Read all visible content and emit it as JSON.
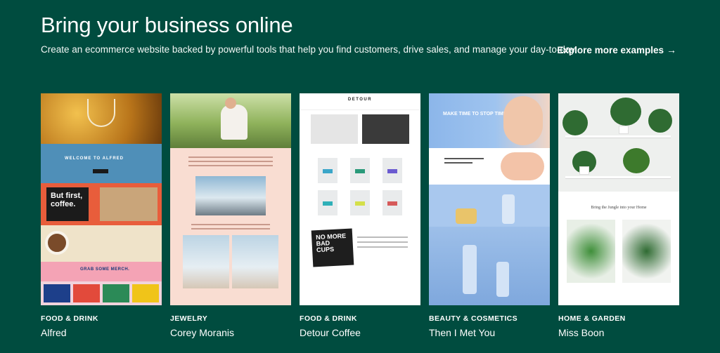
{
  "header": {
    "title": "Bring your business online",
    "subtitle": "Create an ecommerce website backed by powerful tools that help you find customers, drive sales, and manage your day-to-day.",
    "explore_label": "Explore more examples",
    "explore_icon": "arrow-right-icon"
  },
  "colors": {
    "background": "#004c3f",
    "text": "#ffffff"
  },
  "examples": [
    {
      "category": "FOOD & DRINK",
      "name": "Alfred",
      "thumb_text": {
        "welcome": "WELCOME TO ALFRED",
        "slogan": "But first, coffee.",
        "merch": "GRAB SOME MERCH."
      }
    },
    {
      "category": "JEWELRY",
      "name": "Corey Moranis"
    },
    {
      "category": "FOOD & DRINK",
      "name": "Detour Coffee",
      "thumb_text": {
        "brand": "DETOUR",
        "promo": "NO MORE BAD CUPS"
      }
    },
    {
      "category": "BEAUTY & COSMETICS",
      "name": "Then I Met You",
      "thumb_text": {
        "headline": "MAKE TIME TO STOP TIME"
      }
    },
    {
      "category": "HOME & GARDEN",
      "name": "Miss Boon",
      "thumb_text": {
        "tagline": "Bring the Jungle into your Home"
      }
    }
  ]
}
